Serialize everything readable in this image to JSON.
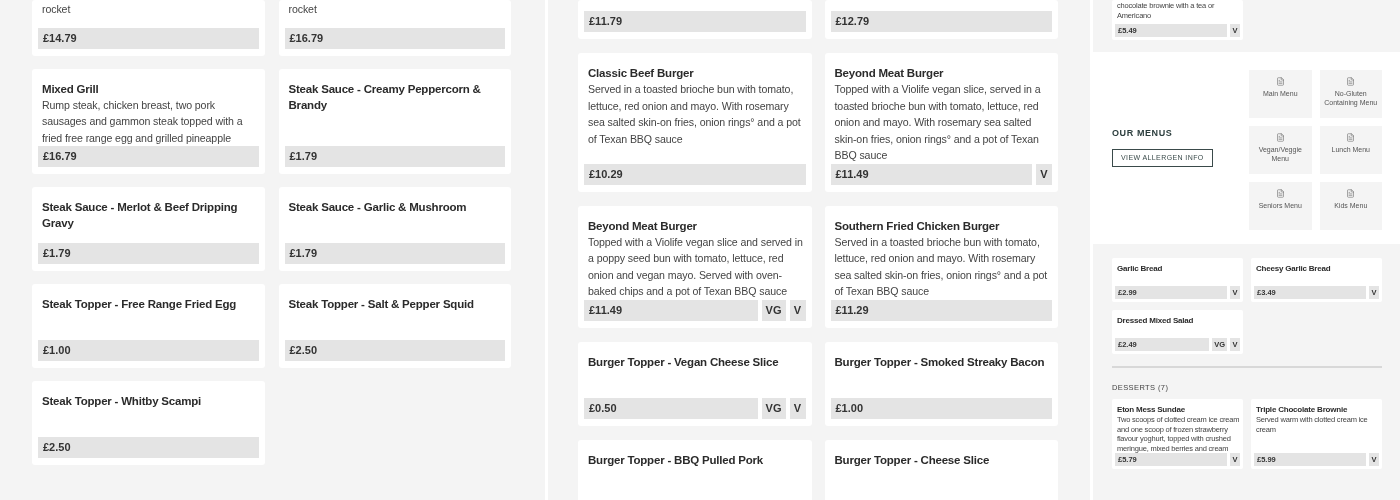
{
  "panels": [
    {
      "kind": "grid",
      "rows": [
        [
          {
            "description": "rocket",
            "price": "£14.79"
          },
          {
            "description": "rocket",
            "price": "£16.79"
          }
        ],
        [
          {
            "title": "Mixed Grill",
            "description": "Rump steak, chicken breast, two pork sausages and gammon steak topped with a fried free range egg and grilled pineapple",
            "price": "£16.79"
          },
          {
            "title": "Steak Sauce - Creamy Peppercorn & Brandy",
            "price": "£1.79"
          }
        ],
        [
          {
            "title": "Steak Sauce - Merlot & Beef Dripping Gravy",
            "price": "£1.79"
          },
          {
            "title": "Steak Sauce - Garlic & Mushroom",
            "price": "£1.79"
          }
        ],
        [
          {
            "title": "Steak Topper - Free Range Fried Egg",
            "price": "£1.00"
          },
          {
            "title": "Steak Topper - Salt & Pepper Squid",
            "price": "£2.50"
          }
        ],
        [
          {
            "title": "Steak Topper - Whitby Scampi",
            "price": "£2.50"
          }
        ]
      ]
    },
    {
      "kind": "grid",
      "rows": [
        [
          {
            "price": "£11.79"
          },
          {
            "price": "£12.79"
          }
        ],
        [
          {
            "title": "Classic Beef Burger",
            "description": "Served in a toasted brioche bun with tomato, lettuce, red onion and mayo. With rosemary sea salted skin-on fries, onion rings° and a pot of Texan BBQ sauce",
            "price": "£10.29"
          },
          {
            "title": "Beyond Meat Burger",
            "description": "Topped with a Violife vegan slice, served in a toasted brioche bun with tomato, lettuce, red onion and mayo. With rosemary sea salted skin-on fries, onion rings° and a pot of Texan BBQ sauce",
            "price": "£11.49",
            "tags": [
              "V"
            ]
          }
        ],
        [
          {
            "title": "Beyond Meat Burger",
            "description": "Topped with a Violife vegan slice and served in a poppy seed bun with tomato, lettuce, red onion and vegan mayo. Served with oven-baked chips and a pot of Texan BBQ sauce",
            "price": "£11.49",
            "tags": [
              "VG",
              "V"
            ]
          },
          {
            "title": "Southern Fried Chicken Burger",
            "description": "Served in a toasted brioche bun with tomato, lettuce, red onion and mayo. With rosemary sea salted skin-on fries, onion rings° and a pot of Texan BBQ sauce",
            "price": "£11.29"
          }
        ],
        [
          {
            "title": "Burger Topper - Vegan Cheese Slice",
            "price": "£0.50",
            "tags": [
              "VG",
              "V"
            ]
          },
          {
            "title": "Burger Topper - Smoked Streaky Bacon",
            "price": "£1.00"
          }
        ],
        [
          {
            "title": "Burger Topper - BBQ Pulled Pork"
          },
          {
            "title": "Burger Topper - Cheese Slice"
          }
        ]
      ]
    },
    {
      "kind": "mixed",
      "top_rows": [
        [
          {
            "description": "chocolate brownie with a tea or Americano",
            "price": "£5.49",
            "tags": [
              "V"
            ]
          }
        ]
      ],
      "our_menus": {
        "heading": "OUR MENUS",
        "button": "VIEW ALLERGEN INFO",
        "tiles": [
          {
            "label": "Main Menu"
          },
          {
            "label": "No-Gluten Containing Menu"
          },
          {
            "label": "Vegan/Veggie Menu"
          },
          {
            "label": "Lunch Menu"
          },
          {
            "label": "Seniors Menu"
          },
          {
            "label": "Kids Menu"
          }
        ]
      },
      "sections": [
        {
          "rows": [
            [
              {
                "title": "Garlic Bread",
                "price": "£2.99",
                "tags": [
                  "V"
                ]
              },
              {
                "title": "Cheesy Garlic Bread",
                "price": "£3.49",
                "tags": [
                  "V"
                ]
              }
            ],
            [
              {
                "title": "Dressed Mixed Salad",
                "price": "£2.49",
                "tags": [
                  "VG",
                  "V"
                ]
              }
            ]
          ]
        },
        {
          "heading": "DESSERTS (7)",
          "rows": [
            [
              {
                "title": "Eton Mess Sundae",
                "description": "Two scoops of clotted cream ice cream and one scoop of frozen strawberry flavour yoghurt, topped with crushed meringue, mixed berries and cream",
                "price": "£5.79",
                "tags": [
                  "V"
                ]
              },
              {
                "title": "Triple Chocolate Brownie",
                "description": "Served warm with clotted cream ice cream",
                "price": "£5.99",
                "tags": [
                  "V"
                ]
              }
            ]
          ]
        }
      ]
    }
  ]
}
